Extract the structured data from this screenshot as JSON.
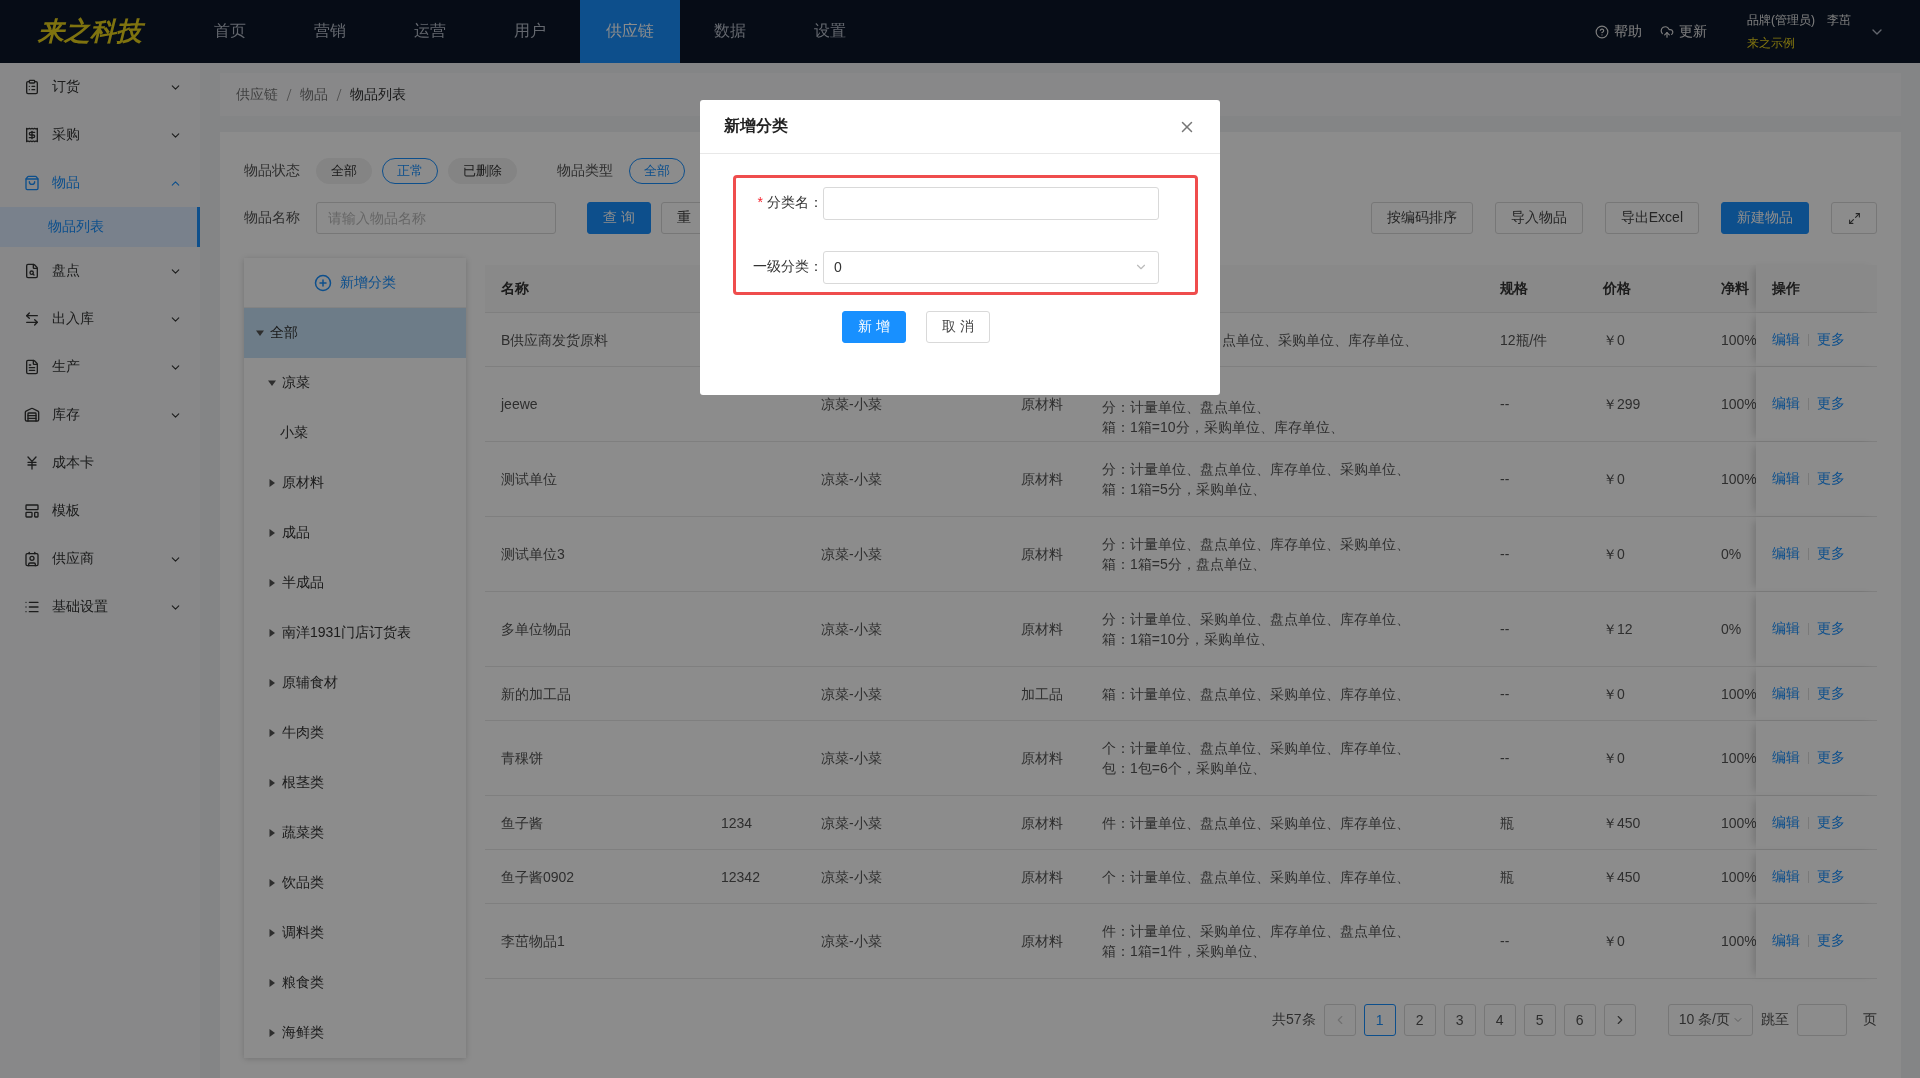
{
  "header": {
    "logo": "来之科技",
    "nav": [
      {
        "label": "首页",
        "selected": false
      },
      {
        "label": "营销",
        "selected": false
      },
      {
        "label": "运营",
        "selected": false
      },
      {
        "label": "用户",
        "selected": false
      },
      {
        "label": "供应链",
        "selected": true
      },
      {
        "label": "数据",
        "selected": false
      },
      {
        "label": "设置",
        "selected": false
      }
    ],
    "help": "帮助",
    "update": "更新",
    "user": {
      "role": "品牌(管理员)",
      "name": "李茁",
      "org": "来之示例"
    }
  },
  "sidebar": {
    "items": [
      {
        "label": "订货",
        "kind": "group",
        "expanded": false,
        "selected": false
      },
      {
        "label": "采购",
        "kind": "group",
        "expanded": false,
        "selected": false
      },
      {
        "label": "物品",
        "kind": "group",
        "expanded": true,
        "selected": true,
        "children": [
          {
            "label": "物品列表",
            "selected": true
          }
        ]
      },
      {
        "label": "盘点",
        "kind": "group",
        "expanded": false,
        "selected": false
      },
      {
        "label": "出入库",
        "kind": "group",
        "expanded": false,
        "selected": false
      },
      {
        "label": "生产",
        "kind": "group",
        "expanded": false,
        "selected": false
      },
      {
        "label": "库存",
        "kind": "group",
        "expanded": false,
        "selected": false
      },
      {
        "label": "成本卡",
        "kind": "link",
        "selected": false
      },
      {
        "label": "模板",
        "kind": "link",
        "selected": false
      },
      {
        "label": "供应商",
        "kind": "group",
        "expanded": false,
        "selected": false
      },
      {
        "label": "基础设置",
        "kind": "group",
        "expanded": false,
        "selected": false
      }
    ]
  },
  "breadcrumb": [
    "供应链",
    "物品",
    "物品列表"
  ],
  "filters": {
    "status": {
      "label": "物品状态",
      "options": [
        {
          "label": "全部",
          "selected": false
        },
        {
          "label": "正常",
          "selected": true
        },
        {
          "label": "已删除",
          "selected": false
        }
      ]
    },
    "type": {
      "label": "物品类型",
      "options": [
        {
          "label": "全部",
          "selected": true
        }
      ]
    },
    "name": {
      "label": "物品名称",
      "placeholder": "请输入物品名称"
    },
    "buttons": [
      {
        "label": "查 询",
        "kind": "primary"
      },
      {
        "label": "重",
        "kind": "default"
      }
    ]
  },
  "toolbar": [
    {
      "label": "按编码排序",
      "kind": "default"
    },
    {
      "label": "导入物品",
      "kind": "default"
    },
    {
      "label": "导出Excel",
      "kind": "default"
    },
    {
      "label": "新建物品",
      "kind": "primary"
    }
  ],
  "tree": {
    "add": "新增分类",
    "items": [
      {
        "label": "全部",
        "kind": "folder",
        "expanded": true,
        "selected": true,
        "children": [
          {
            "label": "凉菜",
            "kind": "folder",
            "expanded": true,
            "selected": false,
            "children": [
              {
                "label": "小菜",
                "kind": "leaf",
                "selected": false
              }
            ]
          },
          {
            "label": "原材料",
            "kind": "folder",
            "expanded": false,
            "selected": false
          },
          {
            "label": "成品",
            "kind": "folder",
            "expanded": false,
            "selected": false
          },
          {
            "label": "半成品",
            "kind": "folder",
            "expanded": false,
            "selected": false
          },
          {
            "label": "南洋1931门店订货表",
            "kind": "folder",
            "expanded": false,
            "selected": false
          },
          {
            "label": "原辅食材",
            "kind": "folder",
            "expanded": false,
            "selected": false
          },
          {
            "label": "牛肉类",
            "kind": "folder",
            "expanded": false,
            "selected": false
          },
          {
            "label": "根茎类",
            "kind": "folder",
            "expanded": false,
            "selected": false
          },
          {
            "label": "蔬菜类",
            "kind": "folder",
            "expanded": false,
            "selected": false
          },
          {
            "label": "饮品类",
            "kind": "folder",
            "expanded": false,
            "selected": false
          },
          {
            "label": "调料类",
            "kind": "folder",
            "expanded": false,
            "selected": false
          },
          {
            "label": "粮食类",
            "kind": "folder",
            "expanded": false,
            "selected": false
          },
          {
            "label": "海鲜类",
            "kind": "folder",
            "expanded": false,
            "selected": false
          }
        ]
      }
    ]
  },
  "table": {
    "header": {
      "name": "名称",
      "spec": "规格",
      "price": "价格",
      "yield": "净料",
      "actions": "操作"
    },
    "rows": [
      {
        "name": "B供应商发货原料",
        "units": [
          "点单位、采购单位、库存单位、"
        ],
        "spec": "12瓶/件",
        "price": "￥0",
        "yield": "100%",
        "actions": [
          "编辑",
          "更多"
        ]
      },
      {
        "name": "jeewe",
        "category": "凉菜-小菜",
        "type": "原材料",
        "units": [
          "分：计量单位、盘点单位、",
          "箱：1箱=10分，采购单位、库存单位、"
        ],
        "spec": "--",
        "price": "￥299",
        "yield": "100%",
        "actions": [
          "编辑",
          "更多"
        ]
      },
      {
        "name": "测试单位",
        "category": "凉菜-小菜",
        "type": "原材料",
        "units": [
          "分：计量单位、盘点单位、库存单位、采购单位、",
          "箱：1箱=5分，采购单位、"
        ],
        "spec": "--",
        "price": "￥0",
        "yield": "100%",
        "actions": [
          "编辑",
          "更多"
        ]
      },
      {
        "name": "测试单位3",
        "category": "凉菜-小菜",
        "type": "原材料",
        "units": [
          "分：计量单位、盘点单位、库存单位、采购单位、",
          "箱：1箱=5分，盘点单位、"
        ],
        "spec": "--",
        "price": "￥0",
        "yield": "0%",
        "actions": [
          "编辑",
          "更多"
        ]
      },
      {
        "name": "多单位物品",
        "category": "凉菜-小菜",
        "type": "原材料",
        "units": [
          "分：计量单位、采购单位、盘点单位、库存单位、",
          "箱：1箱=10分，采购单位、"
        ],
        "spec": "--",
        "price": "￥12",
        "yield": "0%",
        "actions": [
          "编辑",
          "更多"
        ]
      },
      {
        "name": "新的加工品",
        "category": "凉菜-小菜",
        "type": "加工品",
        "units": [
          "箱：计量单位、盘点单位、采购单位、库存单位、"
        ],
        "spec": "--",
        "price": "￥0",
        "yield": "100%",
        "actions": [
          "编辑",
          "更多"
        ]
      },
      {
        "name": "青稞饼",
        "category": "凉菜-小菜",
        "type": "原材料",
        "units": [
          "个：计量单位、盘点单位、采购单位、库存单位、",
          "包：1包=6个，采购单位、"
        ],
        "spec": "--",
        "price": "￥0",
        "yield": "100%",
        "actions": [
          "编辑",
          "更多"
        ]
      },
      {
        "name": "鱼子酱",
        "code": "1234",
        "category": "凉菜-小菜",
        "type": "原材料",
        "units": [
          "件：计量单位、盘点单位、采购单位、库存单位、"
        ],
        "spec": "瓶",
        "price": "￥450",
        "yield": "100%",
        "actions": [
          "编辑",
          "更多"
        ]
      },
      {
        "name": "鱼子酱0902",
        "code": "12342",
        "category": "凉菜-小菜",
        "type": "原材料",
        "units": [
          "个：计量单位、盘点单位、采购单位、库存单位、"
        ],
        "spec": "瓶",
        "price": "￥450",
        "yield": "100%",
        "actions": [
          "编辑",
          "更多"
        ]
      },
      {
        "name": "李茁物品1",
        "category": "凉菜-小菜",
        "type": "原材料",
        "units": [
          "件：计量单位、采购单位、库存单位、盘点单位、",
          "箱：1箱=1件，采购单位、"
        ],
        "spec": "--",
        "price": "￥0",
        "yield": "100%",
        "actions": [
          "编辑",
          "更多"
        ]
      }
    ]
  },
  "pagination": {
    "total": "共57条",
    "prev": {
      "disabled": true
    },
    "next": {
      "disabled": false
    },
    "pages": [
      {
        "label": "1",
        "selected": true
      },
      {
        "label": "2",
        "selected": false
      },
      {
        "label": "3",
        "selected": false
      },
      {
        "label": "4",
        "selected": false
      },
      {
        "label": "5",
        "selected": false
      },
      {
        "label": "6",
        "selected": false
      }
    ],
    "page_size": "10 条/页",
    "jump_label": "跳至",
    "page_suffix": "页"
  },
  "modal": {
    "title": "新增分类",
    "fields": [
      {
        "label": "分类名：",
        "mark": "*",
        "kind": "input"
      },
      {
        "label": "一级分类：",
        "kind": "select",
        "value": "0"
      }
    ],
    "buttons": [
      {
        "label": "新 增",
        "kind": "primary"
      },
      {
        "label": "取 消",
        "kind": "default"
      }
    ]
  }
}
